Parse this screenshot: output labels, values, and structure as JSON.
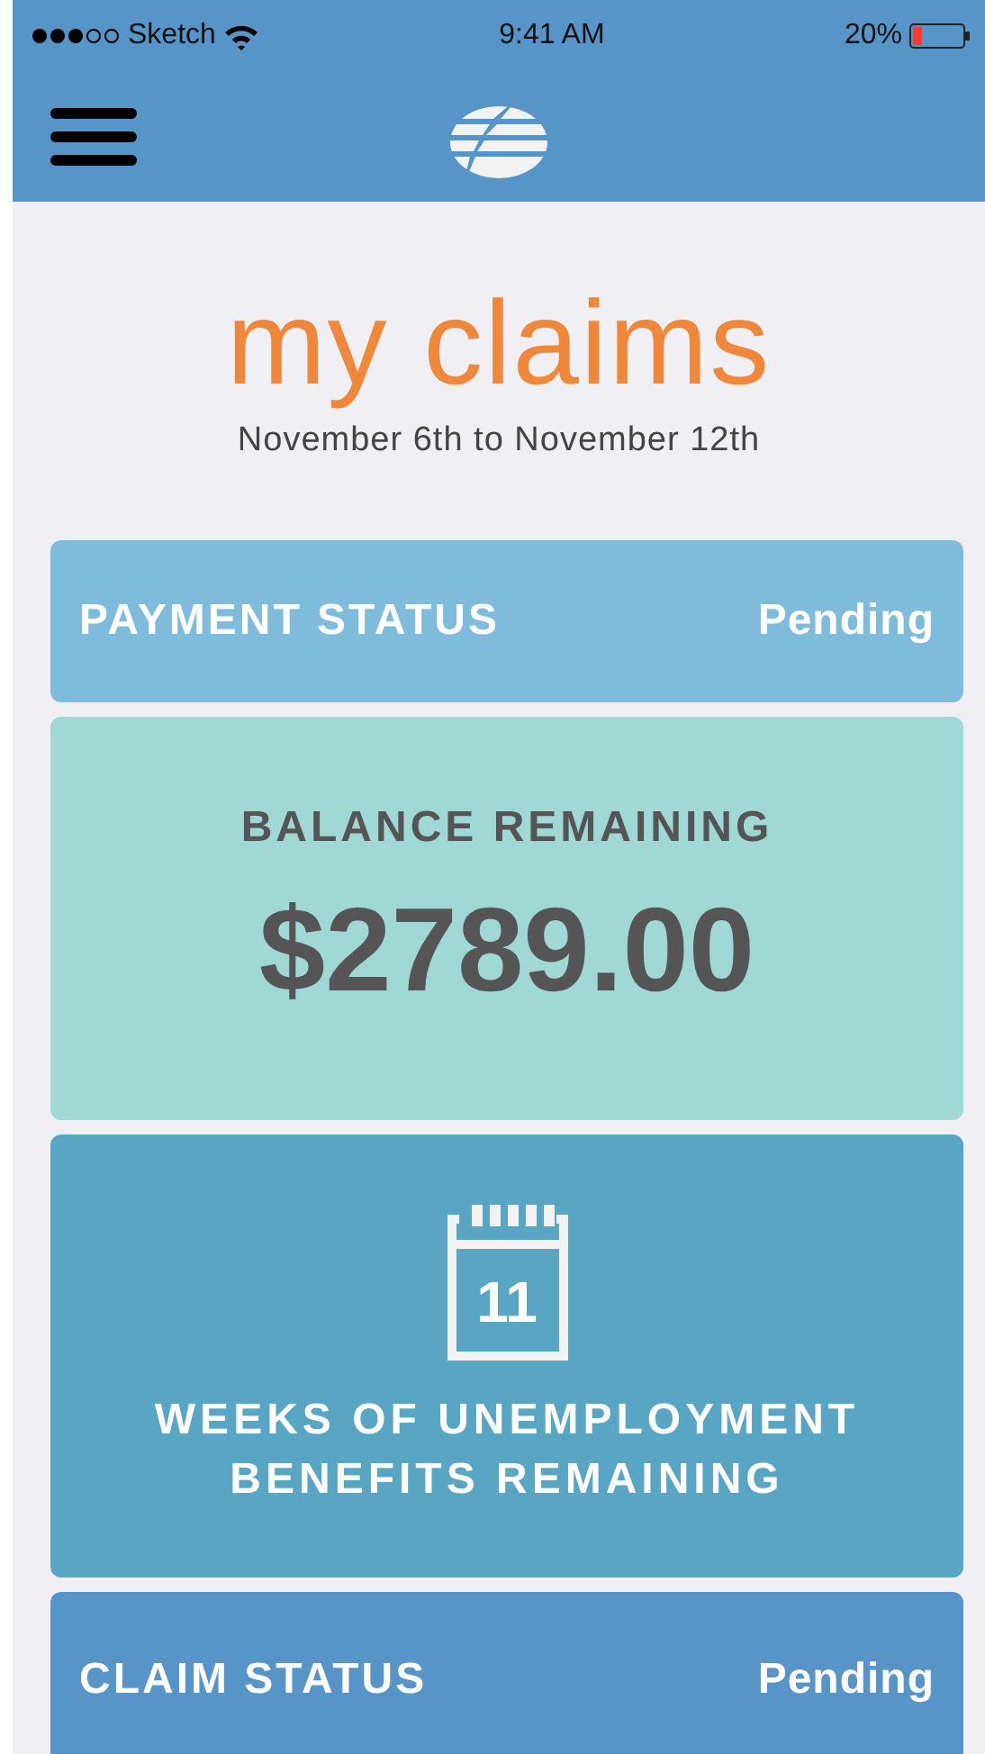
{
  "status_bar": {
    "carrier": "Sketch",
    "time": "9:41 AM",
    "battery": "20%"
  },
  "title": "my claims",
  "date_range": "November 6th to November 12th",
  "cards": [
    {
      "kind": "status",
      "color": "#7fbcdb",
      "label": "PAYMENT STATUS",
      "value": "Pending"
    },
    {
      "kind": "balance",
      "color": "#9fd8d4",
      "label": "BALANCE REMAINING",
      "value": "$2789.00"
    },
    {
      "kind": "weeks",
      "color": "#58a5c4",
      "day": "11",
      "label": "WEEKS OF UNEMPLOYMENT BENEFITS REMAINING"
    },
    {
      "kind": "status",
      "color": "#5794c7",
      "label": "CLAIM STATUS",
      "value": "Pending"
    }
  ]
}
